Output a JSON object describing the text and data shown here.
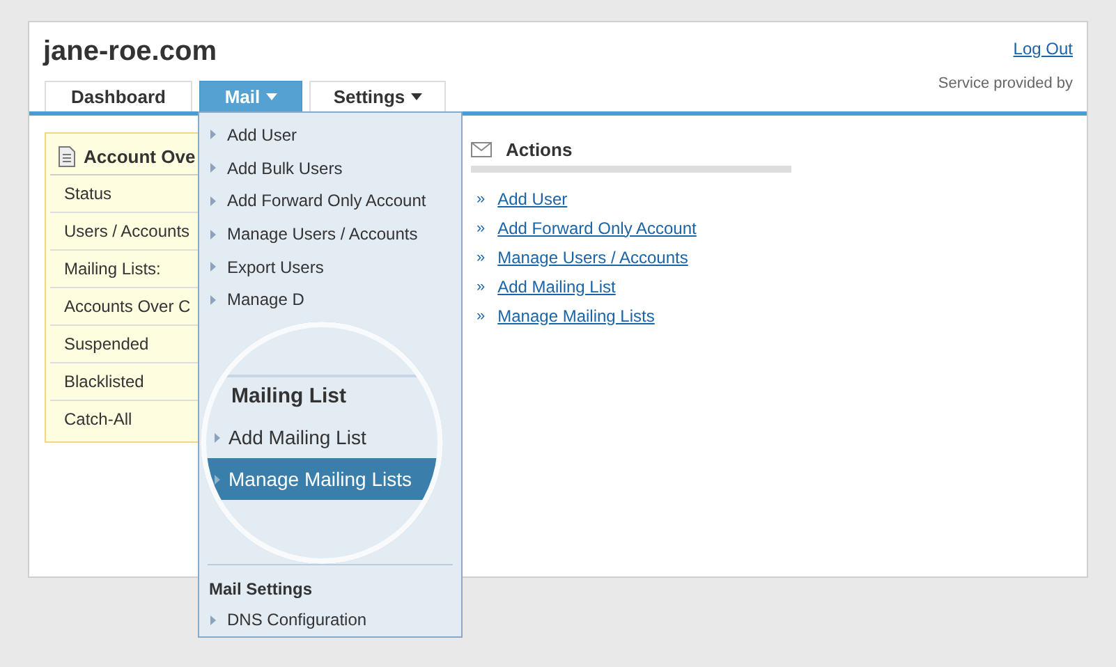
{
  "site_title": "jane-roe.com",
  "logout": "Log Out",
  "service_text": "Service provided by",
  "tabs": [
    {
      "label": "Dashboard",
      "selected": false,
      "caret": false
    },
    {
      "label": "Mail",
      "selected": true,
      "caret": true
    },
    {
      "label": "Settings",
      "selected": false,
      "caret": true
    }
  ],
  "mail_menu": {
    "items": [
      "Add User",
      "Add Bulk Users",
      "Add Forward Only Account",
      "Manage Users / Accounts",
      "Export Users",
      "Manage D"
    ],
    "magnifier": {
      "heading": "Mailing List",
      "items": [
        {
          "label": "Add Mailing List",
          "selected": false
        },
        {
          "label": "Manage Mailing Lists",
          "selected": true
        }
      ]
    },
    "settings_heading": "Mail Settings",
    "settings_items": [
      "DNS Configuration"
    ]
  },
  "overview": {
    "title": "Account Ove",
    "rows": [
      "Status",
      "Users / Accounts",
      "Mailing Lists:",
      "Accounts Over C",
      "Suspended",
      "Blacklisted",
      "Catch-All"
    ]
  },
  "actions": {
    "title": "Actions",
    "bullet": "»",
    "links": [
      "Add User",
      "Add Forward Only Account",
      "Manage Users / Accounts",
      "Add Mailing List",
      "Manage Mailing Lists"
    ]
  }
}
